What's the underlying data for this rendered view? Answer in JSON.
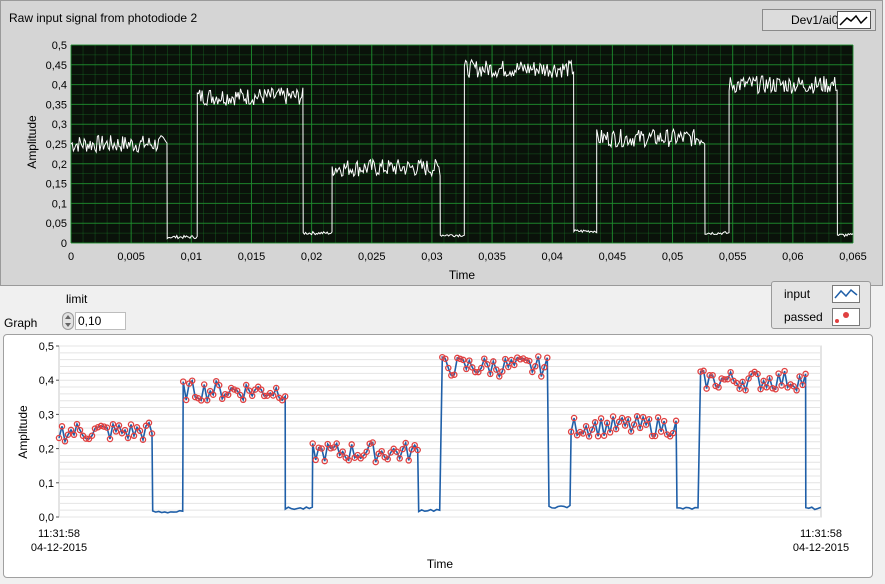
{
  "top_graph": {
    "title": "Raw input signal from photodiode 2",
    "legend_label": "Dev1/ai0",
    "ylabel": "Amplitude",
    "xlabel": "Time",
    "yticks": [
      "0",
      "0,05",
      "0,1",
      "0,15",
      "0,2",
      "0,25",
      "0,3",
      "0,35",
      "0,4",
      "0,45",
      "0,5"
    ],
    "xticks": [
      "0",
      "0,005",
      "0,01",
      "0,015",
      "0,02",
      "0,025",
      "0,03",
      "0,035",
      "0,04",
      "0,045",
      "0,05",
      "0,055",
      "0,06",
      "0,065"
    ],
    "colors": {
      "background": "#0a120a",
      "grid": "#1f8f2f",
      "trace": "#ffffff"
    }
  },
  "controls": {
    "graph_label": "Graph",
    "limit_label": "limit",
    "limit_value": "0,10"
  },
  "bottom_legend": {
    "items": [
      {
        "label": "input",
        "icon": "line-icon"
      },
      {
        "label": "passed",
        "icon": "point-icon"
      }
    ]
  },
  "bottom_graph": {
    "ylabel": "Amplitude",
    "xlabel": "Time",
    "yticks": [
      "0,0",
      "0,1",
      "0,2",
      "0,3",
      "0,4",
      "0,5"
    ],
    "x_start_time": "11:31:58",
    "x_start_date": "04-12-2015",
    "x_end_time": "11:31:58",
    "x_end_date": "04-12-2015",
    "colors": {
      "line": "#1f5fa8",
      "marker": "#e04040",
      "grid": "#e4e4e4"
    }
  },
  "chart_data": [
    {
      "type": "line",
      "title": "Raw input signal from photodiode 2",
      "xlabel": "Time",
      "ylabel": "Amplitude",
      "xlim": [
        0,
        0.065
      ],
      "ylim": [
        0,
        0.5
      ],
      "grid": true,
      "series": [
        {
          "name": "Dev1/ai0",
          "segments": [
            {
              "x": [
                0,
                0.008
              ],
              "level": 0.25
            },
            {
              "x": [
                0.008,
                0.0105
              ],
              "level": 0.015
            },
            {
              "x": [
                0.0105,
                0.0193
              ],
              "level": 0.37
            },
            {
              "x": [
                0.0193,
                0.0217
              ],
              "level": 0.025
            },
            {
              "x": [
                0.0217,
                0.0307
              ],
              "level": 0.19
            },
            {
              "x": [
                0.0307,
                0.0327
              ],
              "level": 0.02
            },
            {
              "x": [
                0.0327,
                0.0418
              ],
              "level": 0.44
            },
            {
              "x": [
                0.0418,
                0.0437
              ],
              "level": 0.03
            },
            {
              "x": [
                0.0437,
                0.0527
              ],
              "level": 0.265
            },
            {
              "x": [
                0.0527,
                0.0547
              ],
              "level": 0.025
            },
            {
              "x": [
                0.0547,
                0.0637
              ],
              "level": 0.4
            },
            {
              "x": [
                0.0637,
                0.065
              ],
              "level": 0.02
            }
          ]
        }
      ]
    },
    {
      "type": "line",
      "xlabel": "Time",
      "ylabel": "Amplitude",
      "ylim": [
        0,
        0.5
      ],
      "grid": true,
      "series": [
        {
          "name": "input",
          "segments": [
            {
              "x": [
                0,
                0.123
              ],
              "level": 0.25
            },
            {
              "x": [
                0.123,
                0.163
              ],
              "level": 0.015
            },
            {
              "x": [
                0.163,
                0.297
              ],
              "level": 0.37
            },
            {
              "x": [
                0.297,
                0.333
              ],
              "level": 0.025
            },
            {
              "x": [
                0.333,
                0.472
              ],
              "level": 0.19
            },
            {
              "x": [
                0.472,
                0.503
              ],
              "level": 0.02
            },
            {
              "x": [
                0.503,
                0.643
              ],
              "level": 0.44
            },
            {
              "x": [
                0.643,
                0.672
              ],
              "level": 0.03
            },
            {
              "x": [
                0.672,
                0.811
              ],
              "level": 0.265
            },
            {
              "x": [
                0.811,
                0.842
              ],
              "level": 0.025
            },
            {
              "x": [
                0.842,
                0.98
              ],
              "level": 0.4
            },
            {
              "x": [
                0.98,
                1.0
              ],
              "level": 0.025
            }
          ]
        },
        {
          "name": "passed",
          "limit": 0.1
        }
      ]
    }
  ]
}
